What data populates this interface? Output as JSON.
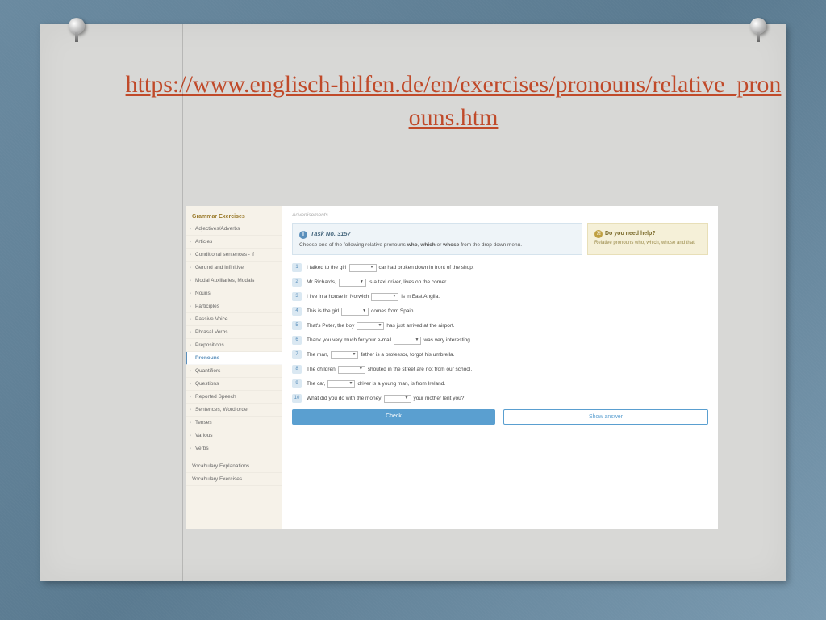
{
  "title_url": "https://www.englisch-hilfen.de/en/exercises/pronouns/relative_pronouns.htm",
  "sidebar": {
    "heading": "Grammar Exercises",
    "items": [
      {
        "label": "Adjectives/Adverbs",
        "active": false
      },
      {
        "label": "Articles",
        "active": false
      },
      {
        "label": "Conditional sentences - if",
        "active": false
      },
      {
        "label": "Gerund and Infinitive",
        "active": false
      },
      {
        "label": "Modal Auxiliaries, Modals",
        "active": false
      },
      {
        "label": "Nouns",
        "active": false
      },
      {
        "label": "Participles",
        "active": false
      },
      {
        "label": "Passive Voice",
        "active": false
      },
      {
        "label": "Phrasal Verbs",
        "active": false
      },
      {
        "label": "Prepositions",
        "active": false
      },
      {
        "label": "Pronouns",
        "active": true
      },
      {
        "label": "Quantifiers",
        "active": false
      },
      {
        "label": "Questions",
        "active": false
      },
      {
        "label": "Reported Speech",
        "active": false
      },
      {
        "label": "Sentences, Word order",
        "active": false
      },
      {
        "label": "Tenses",
        "active": false
      },
      {
        "label": "Various",
        "active": false
      },
      {
        "label": "Verbs",
        "active": false
      }
    ],
    "footer_items": [
      {
        "label": "Vocabulary Explanations"
      },
      {
        "label": "Vocabulary Exercises"
      }
    ]
  },
  "main": {
    "ads_label": "Advertisements",
    "task": {
      "title": "Task No. 3157",
      "desc_pre": "Choose one of the following relative pronouns ",
      "bold1": "who",
      "mid1": ", ",
      "bold2": "which",
      "mid2": " or ",
      "bold3": "whose",
      "desc_post": " from the drop down menu."
    },
    "help": {
      "title": "Do you need help?",
      "link": "Relative pronouns who, which, whose and that"
    },
    "questions": [
      {
        "n": "1",
        "pre": "I talked to the girl ",
        "post": " car had broken down in front of the shop."
      },
      {
        "n": "2",
        "pre": "Mr Richards, ",
        "post": " is a taxi driver, lives on the corner."
      },
      {
        "n": "3",
        "pre": "I live in a house in Norwich ",
        "post": " is in East Anglia."
      },
      {
        "n": "4",
        "pre": "This is the girl ",
        "post": " comes from Spain."
      },
      {
        "n": "5",
        "pre": "That's Peter, the boy ",
        "post": " has just arrived at the airport."
      },
      {
        "n": "6",
        "pre": "Thank you very much for your e-mail ",
        "post": " was very interesting."
      },
      {
        "n": "7",
        "pre": "The man, ",
        "post": " father is a professor, forgot his umbrella."
      },
      {
        "n": "8",
        "pre": "The children ",
        "post": " shouted in the street are not from our school."
      },
      {
        "n": "9",
        "pre": "The car, ",
        "post": " driver is a young man, is from Ireland."
      },
      {
        "n": "10",
        "pre": "What did you do with the money ",
        "post": " your mother lent you?"
      }
    ],
    "buttons": {
      "check": "Check",
      "show": "Show answer"
    }
  }
}
